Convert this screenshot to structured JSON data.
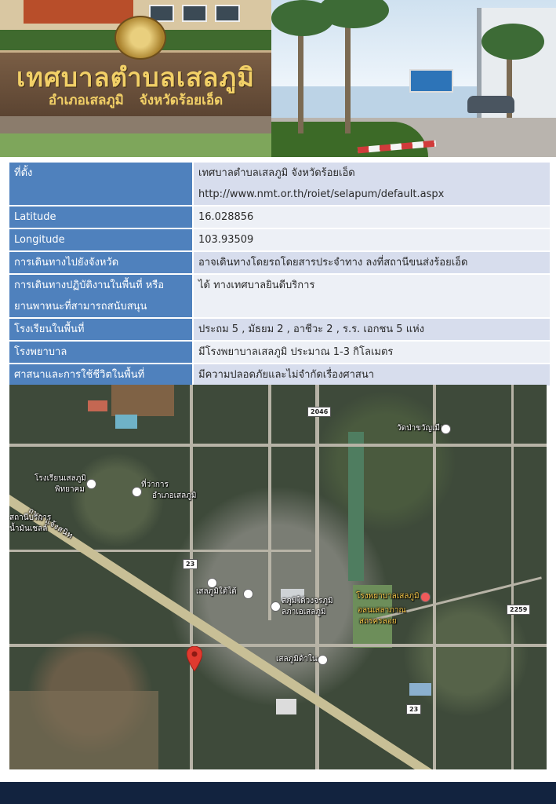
{
  "banner": {
    "sign_title": "เทศบาลตำบลเสลภูมิ",
    "sign_subtitle": "อำเภอเสลภูมิ จังหวัดร้อยเอ็ด"
  },
  "info_table": {
    "rows": [
      {
        "label": "ที่ตั้ง",
        "lines": [
          "เทศบาลตำบลเสลภูมิ จังหวัดร้อยเอ็ด",
          "http://www.nmt.or.th/roiet/selapum/default.aspx"
        ]
      },
      {
        "label": "Latitude",
        "lines": [
          "16.028856"
        ]
      },
      {
        "label": "Longitude",
        "lines": [
          "103.93509"
        ]
      },
      {
        "label": "การเดินทางไปยังจังหวัด",
        "lines": [
          "อาจเดินทางโดยรถโดยสารประจำทาง ลงที่สถานีขนส่งร้อยเอ็ด"
        ]
      },
      {
        "label_lines": [
          "การเดินทางปฏิบัติงานในพื้นที่ หรือ",
          "ยานพาหนะที่สามารถสนับสนุน"
        ],
        "lines": [
          "ได้ ทางเทศบาลยินดีบริการ"
        ]
      },
      {
        "label": "โรงเรียนในพื้นที่",
        "lines": [
          "ประถม 5 , มัธยม 2 , อาชีวะ 2 , ร.ร. เอกชน 5 แห่ง"
        ]
      },
      {
        "label": "โรงพยาบาล",
        "lines": [
          "มีโรงพยาบาลเสลภูมิ ประมาณ 1-3 กิโลเมตร"
        ]
      },
      {
        "label": "ศาสนาและการใช้ชีวิตในพื้นที่",
        "lines": [
          "มีความปลอดภัยและไม่จำกัดเรื่องศาสนา"
        ]
      }
    ]
  },
  "map": {
    "labels": {
      "temple": "วัดป่าขวัญเมือง",
      "school_1": "โรงเรียนเสลภูมิ",
      "school_2": "พิทยาคม",
      "district_office_1": "ที่ว่าการ",
      "district_office_2": "อำเภอเสลภูมิ",
      "highway": "ถนน แจ้งสนิท",
      "gas_station_1": "สถานีบริการ",
      "gas_station_2": "น้ำมันเชลล์",
      "selaphum_north": "เสลภูมิใต้ใต้",
      "municipality_1": "สภูมิใต้วงจรภูมิ",
      "municipality_2": "ลภาเอเสลภูมิ",
      "hospital": "โรงพยาบาลเสลภูมิ",
      "hospital_sub_1": "อลนเสลาภาณ",
      "hospital_sub_2": "สถรครลอย",
      "selaphum_south": "เสลภูมิด้าใน"
    },
    "road_numbers": {
      "north": "2046",
      "center": "23",
      "east": "2259",
      "south": "23"
    },
    "pin_color": "#e03a2f"
  },
  "colors": {
    "header_blue": "#4f81bd",
    "row_light": "#d7dded",
    "row_lighter": "#edf0f6",
    "footer_navy": "#12233f"
  }
}
